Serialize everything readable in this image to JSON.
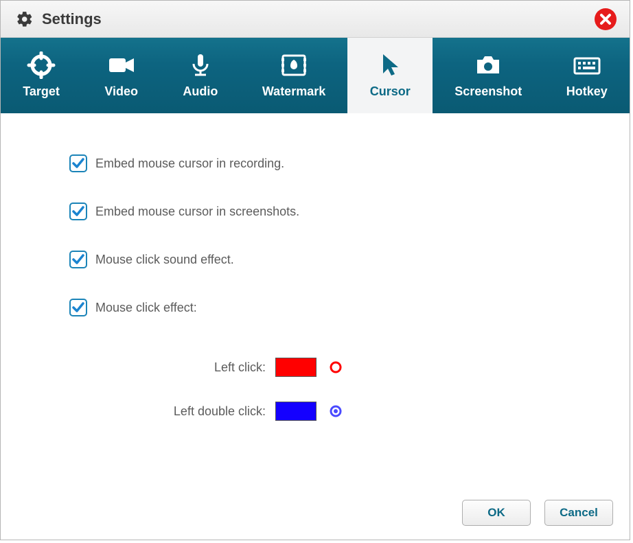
{
  "title": "Settings",
  "tabs": [
    {
      "id": "target",
      "label": "Target",
      "active": false
    },
    {
      "id": "video",
      "label": "Video",
      "active": false
    },
    {
      "id": "audio",
      "label": "Audio",
      "active": false
    },
    {
      "id": "watermark",
      "label": "Watermark",
      "active": false
    },
    {
      "id": "cursor",
      "label": "Cursor",
      "active": true
    },
    {
      "id": "screenshot",
      "label": "Screenshot",
      "active": false
    },
    {
      "id": "hotkey",
      "label": "Hotkey",
      "active": false
    }
  ],
  "options": {
    "embed_recording": {
      "checked": true,
      "label": "Embed mouse cursor in recording."
    },
    "embed_screenshots": {
      "checked": true,
      "label": "Embed mouse cursor in screenshots."
    },
    "click_sound": {
      "checked": true,
      "label": "Mouse click sound effect."
    },
    "click_effect": {
      "checked": true,
      "label": "Mouse click effect:"
    }
  },
  "click_colors": {
    "left": {
      "label": "Left click:",
      "color": "#ff0000"
    },
    "left_double": {
      "label": "Left double click:",
      "color": "#1400ff"
    }
  },
  "buttons": {
    "ok": "OK",
    "cancel": "Cancel"
  }
}
